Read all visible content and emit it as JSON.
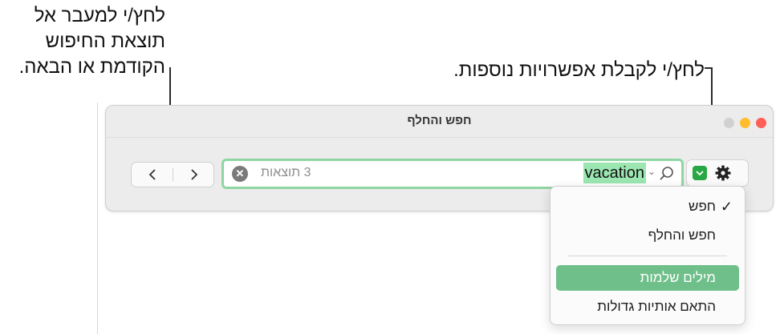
{
  "callouts": {
    "nav_lines": [
      "לחץ/י למעבר אל",
      "תוצאת החיפוש",
      "הקודמת או הבאה."
    ],
    "options": "לחץ/י לקבלת אפשרויות נוספות."
  },
  "window": {
    "title": "חפש והחלף",
    "traffic_lights": [
      "#ff5f57",
      "#febc2e",
      "#d1d1d1"
    ]
  },
  "nav": {
    "prev_icon": "chevron-left-icon",
    "next_icon": "chevron-right-icon"
  },
  "search": {
    "query": "vacation",
    "results": "3 תוצאות",
    "field_border": "#8fd6a3",
    "highlight": "#9be6b1"
  },
  "options_button": {
    "icons": [
      "chevron-down-icon",
      "gear-icon"
    ],
    "accent": "#28a745"
  },
  "menu": {
    "items": [
      {
        "label": "חפש",
        "checked": true
      },
      {
        "label": "חפש והחלף",
        "checked": false
      },
      {
        "label": "מילים שלמות",
        "checked": false,
        "highlighted": true
      },
      {
        "label": "התאם אותיות גדולות",
        "checked": false
      }
    ],
    "highlight_color": "#6fbf8a"
  }
}
